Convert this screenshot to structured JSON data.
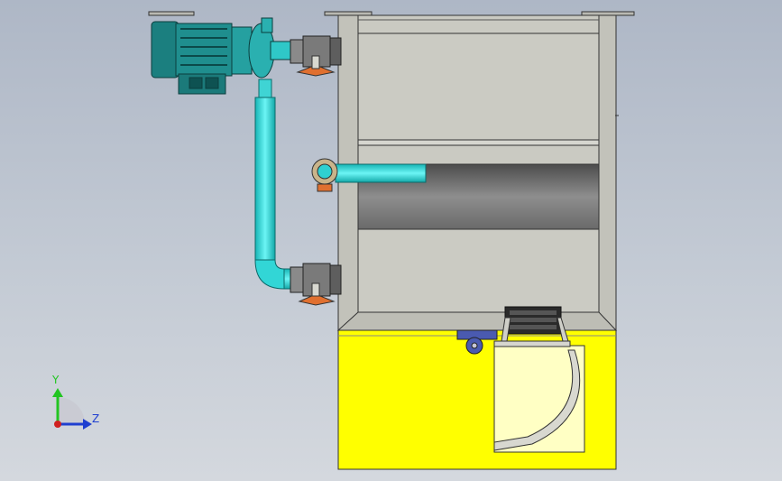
{
  "viewport": {
    "background_top": "#aeb7c6",
    "background_bottom": "#d4d8de"
  },
  "colors": {
    "tank_gray": "#c9c9c0",
    "tank_outline": "#3a3a3a",
    "yellow_base": "#ffff00",
    "pipe_cyan": "#2ee0e0",
    "motor_teal": "#1e8a8a",
    "valve_gray": "#8a8a8a",
    "handle_orange": "#e07030",
    "caster_blue": "#4a5ab0",
    "axis_y": "#22c522",
    "axis_z": "#1f3fd0",
    "axis_x": "#d02020"
  },
  "axis_triad": {
    "y_label": "Y",
    "z_label": "Z"
  }
}
